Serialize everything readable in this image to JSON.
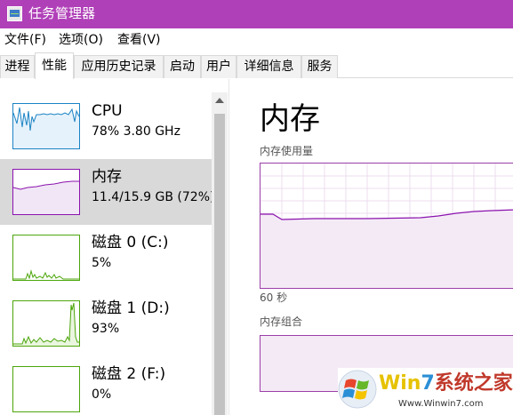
{
  "window": {
    "title": "任务管理器"
  },
  "menu": [
    "文件(F)",
    "选项(O)",
    "查看(V)"
  ],
  "tabs": [
    "进程",
    "性能",
    "应用历史记录",
    "启动",
    "用户",
    "详细信息",
    "服务"
  ],
  "active_tab": "性能",
  "resources": [
    {
      "name": "CPU",
      "detail": "78%  3.80 GHz",
      "color": "#1a83c4"
    },
    {
      "name": "内存",
      "detail": "11.4/15.9 GB (72%)",
      "color": "#8b12ae",
      "selected": true
    },
    {
      "name": "磁盘 0 (C:)",
      "detail": "5%",
      "color": "#4da60c"
    },
    {
      "name": "磁盘 1 (D:)",
      "detail": "93%",
      "color": "#4da60c"
    },
    {
      "name": "磁盘 2 (F:)",
      "detail": "0%",
      "color": "#4da60c"
    }
  ],
  "detail": {
    "title": "内存",
    "usage_label": "内存使用量",
    "time_label": "60 秒",
    "composition_label": "内存组合"
  },
  "watermark": {
    "brand_part1": "Win",
    "brand_part2": "7",
    "brand_part3": "系统之家",
    "url": "Www.Winwin7.com"
  }
}
